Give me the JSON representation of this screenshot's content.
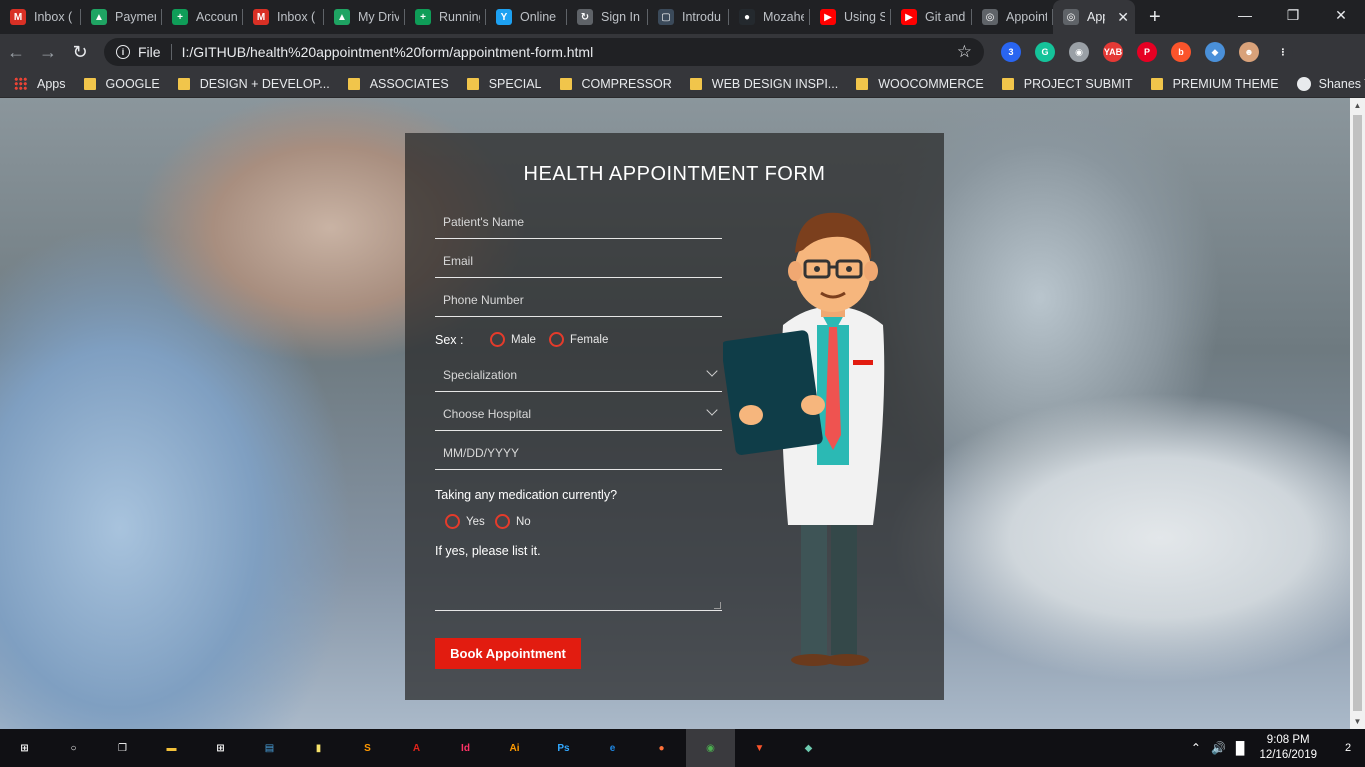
{
  "browser": {
    "tabs": [
      {
        "label": "Inbox (",
        "icon": "gmail-icon",
        "color": "#d93025",
        "glyph": "M"
      },
      {
        "label": "Paymen",
        "icon": "drive-icon",
        "color": "#1fa463",
        "glyph": "▲"
      },
      {
        "label": "Accoun",
        "icon": "sheets-icon",
        "color": "#0f9d58",
        "glyph": "+"
      },
      {
        "label": "Inbox (",
        "icon": "gmail-icon",
        "color": "#d93025",
        "glyph": "M"
      },
      {
        "label": "My Driv",
        "icon": "drive-icon",
        "color": "#1fa463",
        "glyph": "▲"
      },
      {
        "label": "Running",
        "icon": "sheets-icon",
        "color": "#0f9d58",
        "glyph": "+"
      },
      {
        "label": "Online",
        "icon": "envato-icon",
        "color": "#1da1f2",
        "glyph": "Y"
      },
      {
        "label": "Sign In",
        "icon": "sign-in-icon",
        "color": "#5f6368",
        "glyph": "↻"
      },
      {
        "label": "Introdu",
        "icon": "document-icon",
        "color": "#3b4a5a",
        "glyph": "▢"
      },
      {
        "label": "Mozahe",
        "icon": "github-icon",
        "color": "#24292e",
        "glyph": "●"
      },
      {
        "label": "Using S",
        "icon": "youtube-icon",
        "color": "#ff0000",
        "glyph": "▶"
      },
      {
        "label": "Git and",
        "icon": "youtube-icon",
        "color": "#ff0000",
        "glyph": "▶"
      },
      {
        "label": "Appoint",
        "icon": "globe-icon",
        "color": "#5f6368",
        "glyph": "◎"
      },
      {
        "label": "App",
        "icon": "globe-icon",
        "color": "#5f6368",
        "glyph": "◎",
        "active": true
      }
    ],
    "new_tab": "+",
    "window_controls": {
      "minimize": "—",
      "maximize": "❐",
      "close": "✕"
    },
    "address": {
      "protocol": "File",
      "url": "I:/GITHUB/health%20appointment%20form/appointment-form.html"
    },
    "extensions": [
      {
        "name": "css-icon",
        "color": "#2965f1",
        "glyph": "3"
      },
      {
        "name": "grammarly-icon",
        "color": "#15c39a",
        "glyph": "G"
      },
      {
        "name": "camera-icon",
        "color": "#9aa0a6",
        "glyph": "◉"
      },
      {
        "name": "yab-icon",
        "color": "#e53935",
        "glyph": "YAB"
      },
      {
        "name": "pinterest-icon",
        "color": "#e60023",
        "glyph": "P"
      },
      {
        "name": "brave-rewards-icon",
        "color": "#fb542b",
        "glyph": "b"
      },
      {
        "name": "extension-icon",
        "color": "#4a90d9",
        "glyph": "◆"
      },
      {
        "name": "profile-avatar-icon",
        "color": "#d9a27a",
        "glyph": "☻"
      },
      {
        "name": "menu-icon",
        "color": "#35363a",
        "glyph": "⋮"
      }
    ],
    "bookmarks": [
      {
        "label": "Apps",
        "type": "apps"
      },
      {
        "label": "GOOGLE",
        "type": "folder"
      },
      {
        "label": "DESIGN + DEVELOP...",
        "type": "folder"
      },
      {
        "label": "ASSOCIATES",
        "type": "folder"
      },
      {
        "label": "SPECIAL",
        "type": "folder"
      },
      {
        "label": "COMPRESSOR",
        "type": "folder"
      },
      {
        "label": "WEB DESIGN INSPI...",
        "type": "folder"
      },
      {
        "label": "WOOCOMMERCE",
        "type": "folder"
      },
      {
        "label": "PROJECT SUBMIT",
        "type": "folder"
      },
      {
        "label": "PREMIUM THEME",
        "type": "folder"
      },
      {
        "label": "Shanes Tools",
        "type": "globe"
      }
    ],
    "bookmarks_more": "»"
  },
  "form": {
    "title": "HEALTH APPOINTMENT FORM",
    "name_placeholder": "Patient's Name",
    "email_placeholder": "Email",
    "phone_placeholder": "Phone Number",
    "sex_label": "Sex :",
    "sex_options": [
      "Male",
      "Female"
    ],
    "specialization_placeholder": "Specialization",
    "hospital_placeholder": "Choose Hospital",
    "date_placeholder": "MM/DD/YYYY",
    "medication_question": "Taking any medication currently?",
    "medication_options": [
      "Yes",
      "No"
    ],
    "list_label": "If yes, please list it.",
    "submit_label": "Book Appointment",
    "accent_color": "#e21c10"
  },
  "taskbar": {
    "apps": [
      {
        "name": "windows-start-icon",
        "color": "#ffffff",
        "glyph": "⊞"
      },
      {
        "name": "search-circle-icon",
        "color": "#ffffff",
        "glyph": "○"
      },
      {
        "name": "task-view-icon",
        "color": "#ffffff",
        "glyph": "❐"
      },
      {
        "name": "file-explorer-icon",
        "color": "#f3c13a",
        "glyph": "▬"
      },
      {
        "name": "store-icon",
        "color": "#ffffff",
        "glyph": "⊞"
      },
      {
        "name": "control-panel-icon",
        "color": "#4aa3df",
        "glyph": "▤"
      },
      {
        "name": "sticky-notes-icon",
        "color": "#f7e36b",
        "glyph": "▮"
      },
      {
        "name": "sublime-text-icon",
        "color": "#ff9800",
        "glyph": "S"
      },
      {
        "name": "acrobat-icon",
        "color": "#e2231a",
        "glyph": "A"
      },
      {
        "name": "indesign-icon",
        "color": "#ff3366",
        "glyph": "Id"
      },
      {
        "name": "illustrator-icon",
        "color": "#ff9a00",
        "glyph": "Ai"
      },
      {
        "name": "photoshop-icon",
        "color": "#31a8ff",
        "glyph": "Ps"
      },
      {
        "name": "edge-icon",
        "color": "#1e88e5",
        "glyph": "e"
      },
      {
        "name": "firefox-icon",
        "color": "#ff7139",
        "glyph": "●"
      },
      {
        "name": "chrome-icon",
        "color": "#4caf50",
        "glyph": "◉",
        "active": true
      },
      {
        "name": "brave-icon",
        "color": "#fb542b",
        "glyph": "▼"
      },
      {
        "name": "gitkraken-icon",
        "color": "#6dcaaf",
        "glyph": "◆"
      }
    ],
    "time": "9:08 PM",
    "date": "12/16/2019",
    "notifications": "2"
  }
}
